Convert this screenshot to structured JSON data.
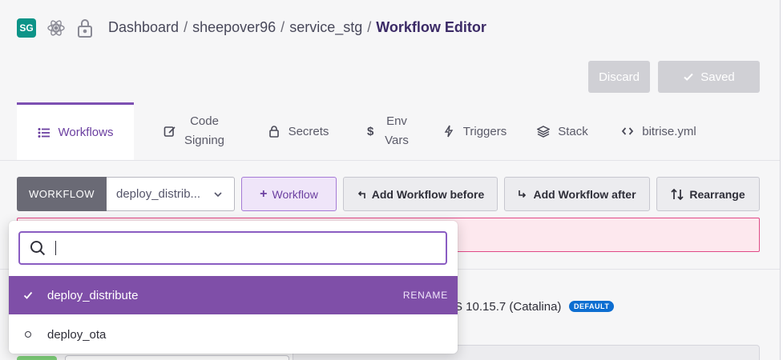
{
  "header": {
    "badge": "SG",
    "breadcrumb": {
      "root": "Dashboard",
      "org": "sheepover96",
      "app": "service_stg",
      "current": "Workflow Editor",
      "separator": "/"
    }
  },
  "actions": {
    "discard_label": "Discard",
    "saved_label": "Saved"
  },
  "tabs": [
    {
      "label": "Workflows",
      "icon": "list-icon",
      "active": true
    },
    {
      "label_line1": "Code",
      "label_line2": "Signing",
      "icon": "edit-icon"
    },
    {
      "label": "Secrets",
      "icon": "lock-icon"
    },
    {
      "label_line1": "Env",
      "label_line2": "Vars",
      "icon": "dollar-icon"
    },
    {
      "label": "Triggers",
      "icon": "bolt-icon"
    },
    {
      "label": "Stack",
      "icon": "layers-icon"
    },
    {
      "label": "bitrise.yml",
      "icon": "code-icon"
    }
  ],
  "toolbar": {
    "workflow_label": "WORKFLOW",
    "selected_workflow": "deploy_distrib...",
    "add_workflow_label": "Workflow",
    "add_before_label": "Add Workflow before",
    "add_after_label": "Add Workflow after",
    "rearrange_label": "Rearrange"
  },
  "stack": {
    "text": "S 10.15.7 (Catalina)",
    "badge": "DEFAULT"
  },
  "dropdown": {
    "search_value": "",
    "items": [
      {
        "label": "deploy_distribute",
        "selected": true,
        "action": "RENAME"
      },
      {
        "label": "deploy_ota",
        "selected": false
      }
    ]
  },
  "colors": {
    "accent": "#7f4fa8",
    "badge_green": "#0d9488",
    "alert_border": "#e04a87",
    "default_badge": "#0d6ed1"
  }
}
